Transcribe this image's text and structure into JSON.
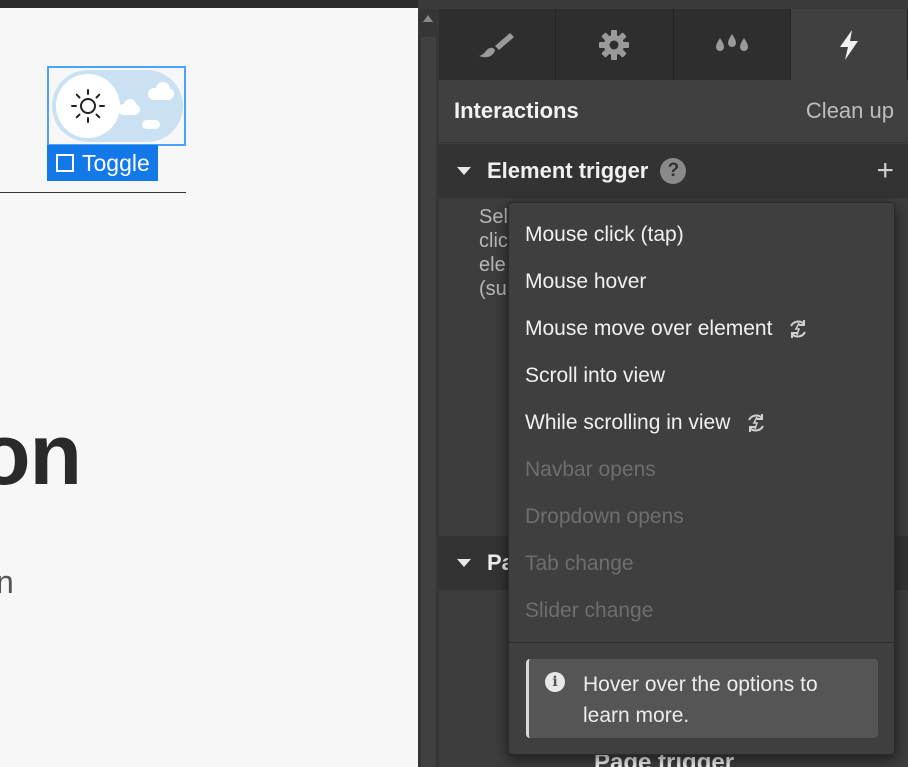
{
  "canvas": {
    "selection_label": "Toggle",
    "heading_fragment": "on",
    "subtext_fragment": "n"
  },
  "tabs": [
    {
      "icon": "brush-icon"
    },
    {
      "icon": "gear-icon"
    },
    {
      "icon": "drops-icon"
    },
    {
      "icon": "lightning-icon",
      "active": true
    }
  ],
  "interactions": {
    "title": "Interactions",
    "cleanup_label": "Clean up"
  },
  "element_trigger": {
    "label": "Element trigger",
    "help": "?",
    "add": "+",
    "desc_lines": [
      "Sel",
      "clic",
      "ele",
      "(su"
    ]
  },
  "page_trigger": {
    "label_fragment": "Pa",
    "bottom_label": "Page trigger"
  },
  "dropdown": {
    "items": [
      {
        "label": "Mouse click (tap)",
        "disabled": false,
        "live": false
      },
      {
        "label": "Mouse hover",
        "disabled": false,
        "live": false
      },
      {
        "label": "Mouse move over element",
        "disabled": false,
        "live": true
      },
      {
        "label": "Scroll into view",
        "disabled": false,
        "live": false
      },
      {
        "label": "While scrolling in view",
        "disabled": false,
        "live": true
      },
      {
        "label": "Navbar opens",
        "disabled": true,
        "live": false
      },
      {
        "label": "Dropdown opens",
        "disabled": true,
        "live": false
      },
      {
        "label": "Tab change",
        "disabled": true,
        "live": false
      },
      {
        "label": "Slider change",
        "disabled": true,
        "live": false
      }
    ],
    "hint": "Hover over the options to learn more.",
    "hint_icon": "i"
  },
  "colors": {
    "selection_blue": "#1479e8",
    "panel_bg": "#404040",
    "disabled_text": "#6e6e6e"
  }
}
